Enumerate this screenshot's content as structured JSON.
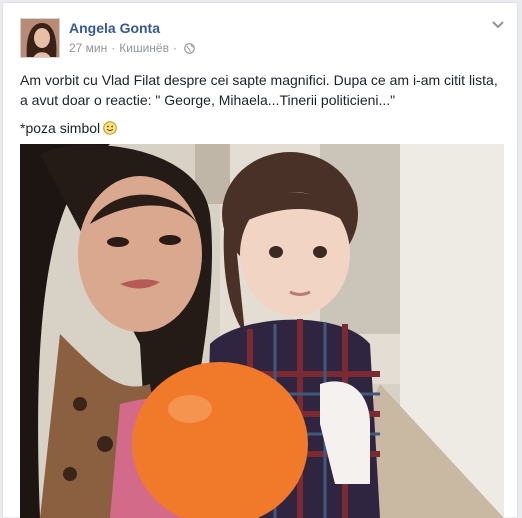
{
  "post": {
    "author": "Angela Gonta",
    "time": "27 мин",
    "separator": "·",
    "location": "Кишинёв",
    "separator2": "·",
    "text_line1": "Am vorbit cu Vlad Filat despre cei sapte magnifici. Dupa ce am i-am citit lista, a avut doar o reactie: \" George, Mihaela...Tinerii politicieni...\"",
    "text_line2": "*poza simbol",
    "icons": [
      "globe-icon",
      "chevron-down-icon",
      "smiley-icon"
    ]
  },
  "colors": {
    "author_link": "#365899",
    "meta_gray": "#90949c",
    "text": "#1d2129",
    "balloon": "#f07a2a"
  }
}
